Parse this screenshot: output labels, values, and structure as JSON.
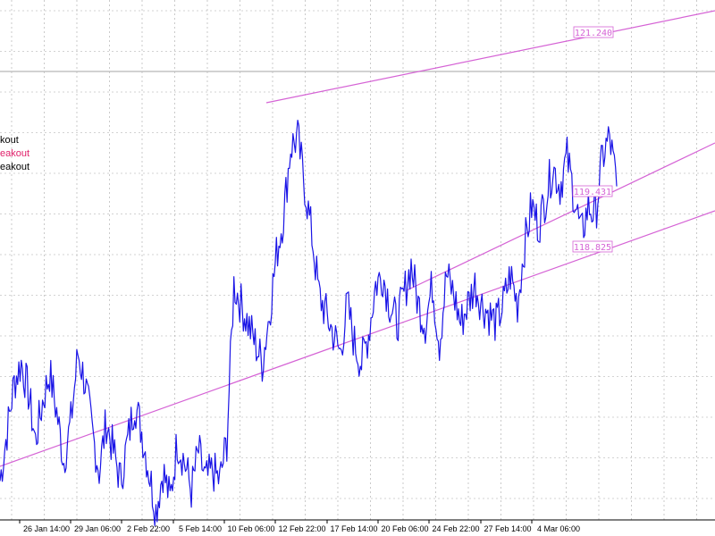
{
  "legend": [
    {
      "text": "kout",
      "color": "#000000"
    },
    {
      "text": "eakout",
      "color": "#e0206a"
    },
    {
      "text": "eakout",
      "color": "#000000"
    }
  ],
  "colors": {
    "price": "#1a14e6",
    "trendline": "#d563d5",
    "grid": "#a8a8a8",
    "hline": "#b8b8b8"
  },
  "chart_data": {
    "type": "line",
    "x_tick_labels": [
      "26 Jan 14:00",
      "29 Jan 06:00",
      "2 Feb 22:00",
      "5 Feb 14:00",
      "10 Feb 06:00",
      "12 Feb 22:00",
      "17 Feb 14:00",
      "20 Feb 06:00",
      "24 Feb 22:00",
      "27 Feb 14:00",
      "4 Mar 06:00"
    ],
    "price_labels": [
      "121.240",
      "119.431",
      "118.825"
    ],
    "ylim": [
      116.5,
      121.8
    ],
    "grid": true,
    "series": [
      {
        "values": [
          116.9,
          117.4,
          117.9,
          118.1,
          117.8,
          117.3,
          117.7,
          118.0,
          117.6,
          117.1,
          117.5,
          118.2,
          117.9,
          117.4,
          117.0,
          117.5,
          117.2,
          116.9,
          117.3,
          117.7,
          117.4,
          117.0,
          116.6,
          117.0,
          116.7,
          117.3,
          117.1,
          116.8,
          117.2,
          116.9,
          117.0,
          116.9,
          117.3,
          118.9,
          118.7,
          118.5,
          118.3,
          118.1,
          118.6,
          119.2,
          119.6,
          120.3,
          120.4,
          119.9,
          119.4,
          118.8,
          118.6,
          118.4,
          118.2,
          118.7,
          118.3,
          118.1,
          118.4,
          118.9,
          119.0,
          118.7,
          118.5,
          118.8,
          119.1,
          118.7,
          118.5,
          118.9,
          118.3,
          119.0,
          118.8,
          118.5,
          118.7,
          118.9,
          118.7,
          118.6,
          118.5,
          118.7,
          119.0,
          118.7,
          119.3,
          119.7,
          119.5,
          119.8,
          120.1,
          119.9,
          120.2,
          119.8,
          119.4,
          119.7,
          119.6,
          120.2,
          120.4,
          119.9
        ]
      }
    ]
  }
}
